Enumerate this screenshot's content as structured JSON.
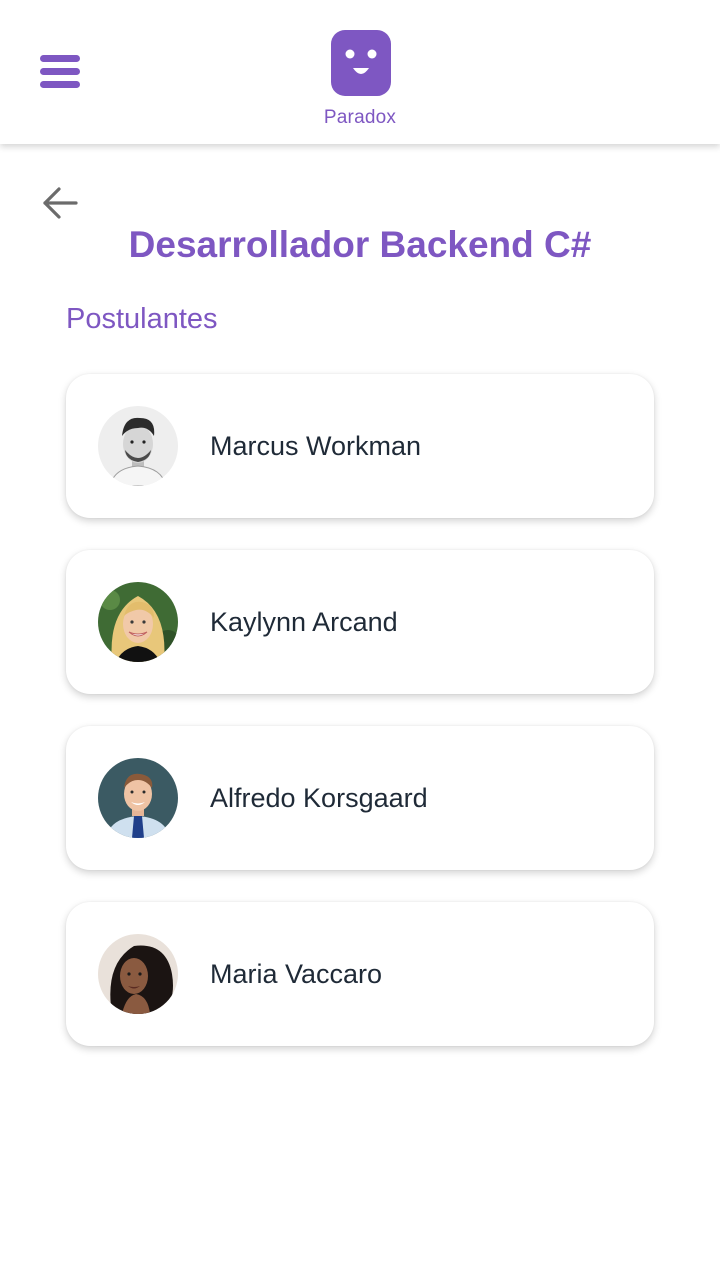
{
  "header": {
    "brand_name": "Paradox",
    "menu_icon": "hamburger-menu-icon",
    "logo_icon": "smiley-logo-icon",
    "accent_color": "#7e57c2"
  },
  "page": {
    "back_icon": "arrow-left-icon",
    "title": "Desarrollador Backend C#",
    "section_title": "Postulantes"
  },
  "applicants": [
    {
      "name": "Marcus Workman",
      "avatar_icon": "avatar-photo"
    },
    {
      "name": "Kaylynn Arcand",
      "avatar_icon": "avatar-photo"
    },
    {
      "name": "Alfredo Korsgaard",
      "avatar_icon": "avatar-photo"
    },
    {
      "name": "Maria Vaccaro",
      "avatar_icon": "avatar-photo"
    }
  ]
}
